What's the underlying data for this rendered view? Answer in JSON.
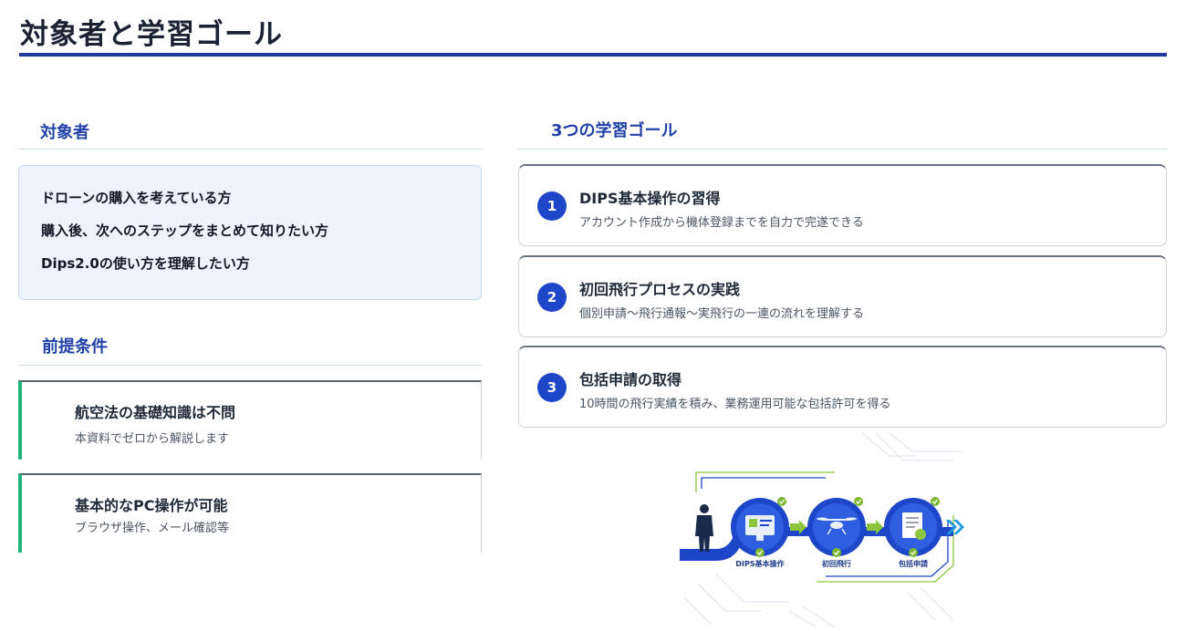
{
  "header": {
    "title": "対象者と学習ゴール"
  },
  "audience": {
    "heading": "対象者",
    "items": [
      "ドローンの購入を考えている方",
      "購入後、次へのステップをまとめて知りたい方",
      "Dips2.0の使い方を理解したい方"
    ]
  },
  "prerequisites": {
    "heading": "前提条件",
    "items": [
      {
        "title": "航空法の基礎知識は不問",
        "desc": "本資料でゼロから解説します"
      },
      {
        "title": "基本的なPC操作が可能",
        "desc": "ブラウザ操作、メール確認等"
      }
    ]
  },
  "goals": {
    "heading": "3つの学習ゴール",
    "items": [
      {
        "num": "1",
        "title": "DIPS基本操作の習得",
        "desc": "アカウント作成から機体登録までを自力で完遂できる"
      },
      {
        "num": "2",
        "title": "初回飛行プロセスの実践",
        "desc": "個別申請〜飛行通報〜実飛行の一連の流れを理解する"
      },
      {
        "num": "3",
        "title": "包括申請の取得",
        "desc": "10時間の飛行実績を積み、業務運用可能な包括許可を得る"
      }
    ]
  },
  "illustration": {
    "labels": [
      "DIPS基本操作",
      "初回飛行",
      "包括申請"
    ]
  },
  "colors": {
    "accent": "#1e46c8",
    "heading": "#2242a8",
    "prereq_bar": "#1fb47e",
    "check": "#7cb82f",
    "audience_bg": "#eef4fd"
  }
}
